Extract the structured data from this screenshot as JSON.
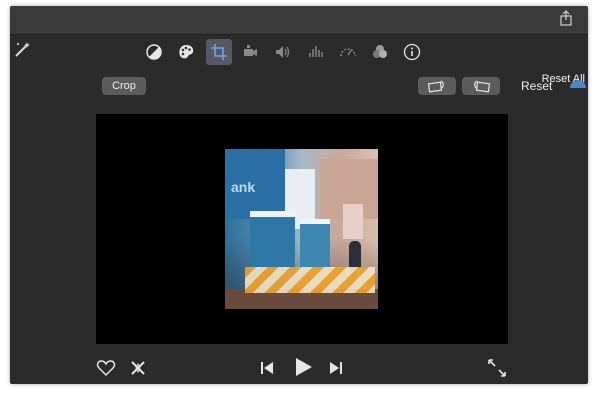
{
  "toolbar": {
    "tools": [
      "color-balance",
      "color-correction",
      "crop",
      "stabilization",
      "volume",
      "noise-reduction",
      "speed",
      "clip-filter",
      "info"
    ],
    "reset_all_label": "Reset All"
  },
  "crop": {
    "crop_label": "Crop",
    "reset_label": "Reset"
  },
  "photo": {
    "sign_text": "ank"
  },
  "colors": {
    "accent": "#4a86c8",
    "arrow": "#e01c1c",
    "active_tool_bg": "#555a66"
  }
}
